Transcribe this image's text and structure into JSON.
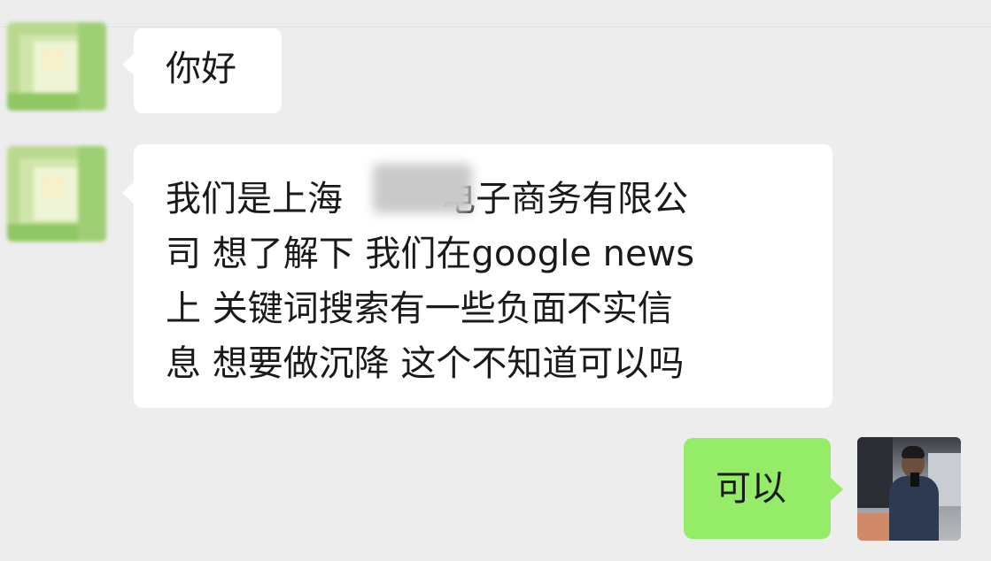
{
  "conversation": {
    "messages": [
      {
        "sender": "contact",
        "avatar": "pixelated-avatar",
        "lines": [
          "你好"
        ]
      },
      {
        "sender": "contact",
        "avatar": "pixelated-avatar",
        "lines": [
          "我们是上海",
          "电子商务有限公",
          "司 想了解下 我们在google news",
          "上 关键词搜索有一些负面不实信",
          "息 想要做沉降 这个不知道可以吗"
        ]
      },
      {
        "sender": "self",
        "avatar": "photo-avatar",
        "lines": [
          "可以"
        ]
      }
    ]
  },
  "colors": {
    "background": "#ededed",
    "incoming_bubble": "#ffffff",
    "outgoing_bubble": "#95ec69",
    "text": "#1a1a1a"
  }
}
